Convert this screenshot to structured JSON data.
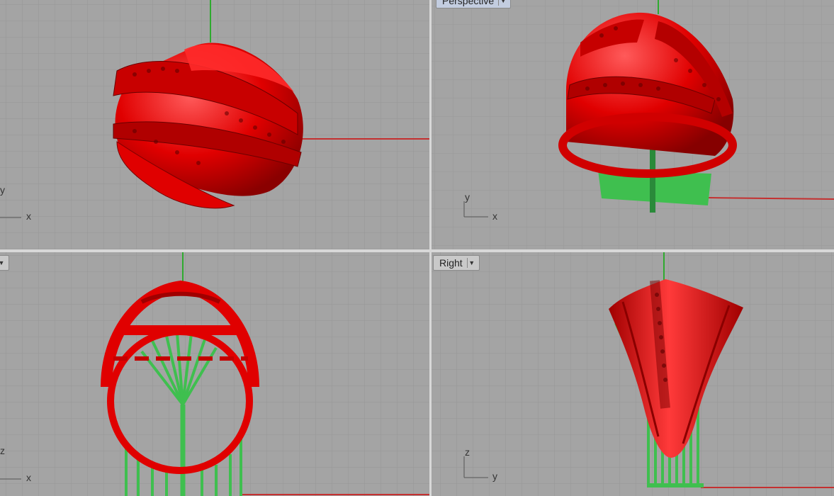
{
  "viewports": {
    "top": {
      "axis_x": "x",
      "axis_y": "y"
    },
    "perspective": {
      "title": "Perspective",
      "axis_x": "x",
      "axis_y": "y"
    },
    "front": {
      "axis_x": "x",
      "axis_y": "z"
    },
    "right": {
      "title": "Right",
      "axis_x": "y",
      "axis_y": "z"
    }
  },
  "colors": {
    "background": "#a4a4a4",
    "grid": "#979797",
    "ring": "#e00000",
    "support": "#3fbf4f",
    "axis_x": "#c43030",
    "axis_y": "#2faa2f"
  },
  "icons": {
    "dropdown": "chevron-down-icon"
  }
}
